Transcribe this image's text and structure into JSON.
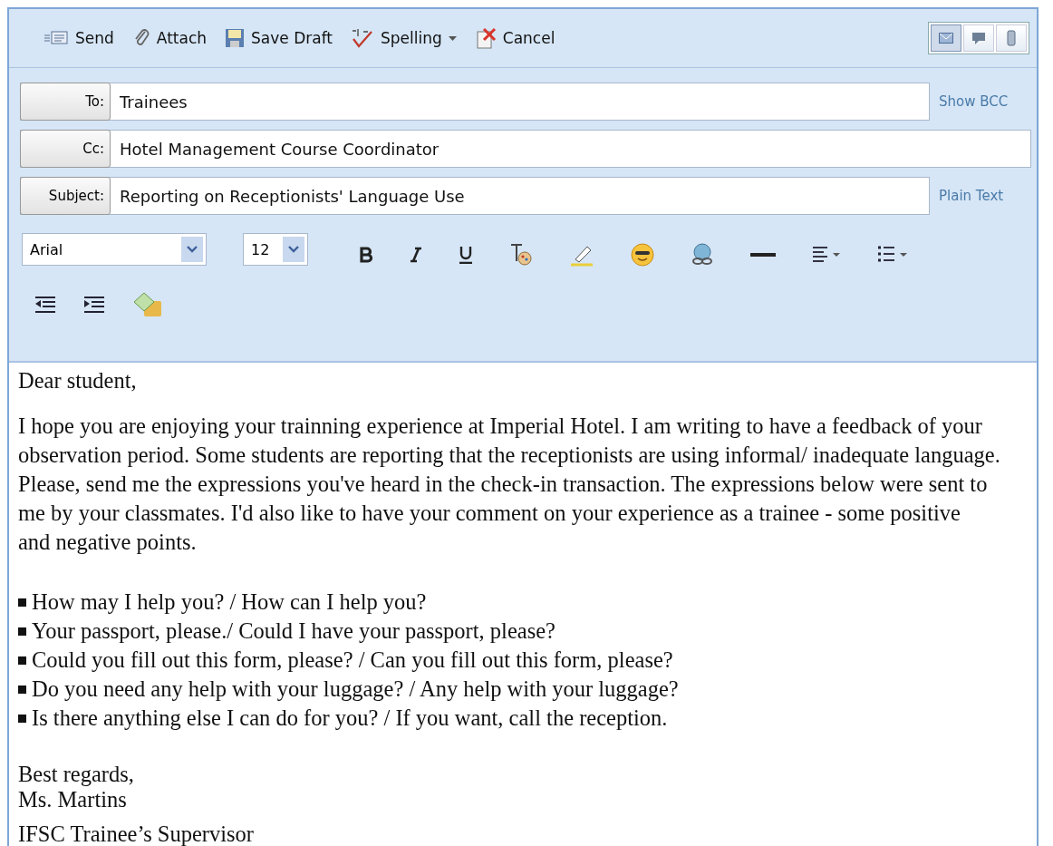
{
  "toolbar": {
    "actions": [
      {
        "kind": "send",
        "label": "Send"
      },
      {
        "kind": "attach",
        "label": "Attach"
      },
      {
        "kind": "save",
        "label": "Save Draft"
      },
      {
        "kind": "spelling",
        "label": "Spelling",
        "dropdown": true
      },
      {
        "kind": "cancel",
        "label": "Cancel"
      }
    ],
    "views": [
      {
        "kind": "mail",
        "selected": true
      },
      {
        "kind": "chat",
        "selected": false
      },
      {
        "kind": "phone",
        "selected": false
      }
    ]
  },
  "fields": [
    {
      "label": "To:",
      "value": "Trainees",
      "link": "Show BCC"
    },
    {
      "label": "Cc:",
      "value": "Hotel Management Course Coordinator"
    },
    {
      "label": "Subject:",
      "value": "Reporting on Receptionists' Language Use",
      "link": "Plain Text"
    }
  ],
  "format": {
    "font": "Arial",
    "size": "12",
    "rows": [
      [
        {
          "kind": "bold"
        },
        {
          "kind": "italic"
        },
        {
          "kind": "underline"
        },
        {
          "kind": "textcolor"
        },
        {
          "kind": "highlight"
        },
        {
          "kind": "emoticon"
        },
        {
          "kind": "link"
        },
        {
          "kind": "rule"
        },
        {
          "kind": "align"
        },
        {
          "kind": "list"
        }
      ],
      [
        {
          "kind": "outdent"
        },
        {
          "kind": "indent"
        },
        {
          "kind": "image"
        }
      ]
    ]
  },
  "body": {
    "greeting": "Dear student,",
    "paragraph": [
      "I hope you are enjoying your trainning experience at Imperial Hotel. I am writing to have a feedback of your",
      "observation period. Some students are reporting that the receptionists are using informal/ inadequate language.",
      "Please, send me the expressions you've heard in the check-in transaction. The expressions below were sent to",
      "me by your classmates. I'd also like to have your comment on your experience as a trainee - some positive",
      "and negative points."
    ],
    "bullets": [
      "How may I help you? /  How can I help you?",
      "Your passport, please./ Could I have your passport, please?",
      "Could you fill out this form, please? / Can you fill out this form, please?",
      "Do you need any help with your luggage? / Any help with your luggage?",
      "Is there anything else I can do for you? / If you want, call the reception."
    ],
    "closing": "Best regards,",
    "name": "Ms. Martins",
    "title": "IFSC Trainee’s Supervisor"
  }
}
